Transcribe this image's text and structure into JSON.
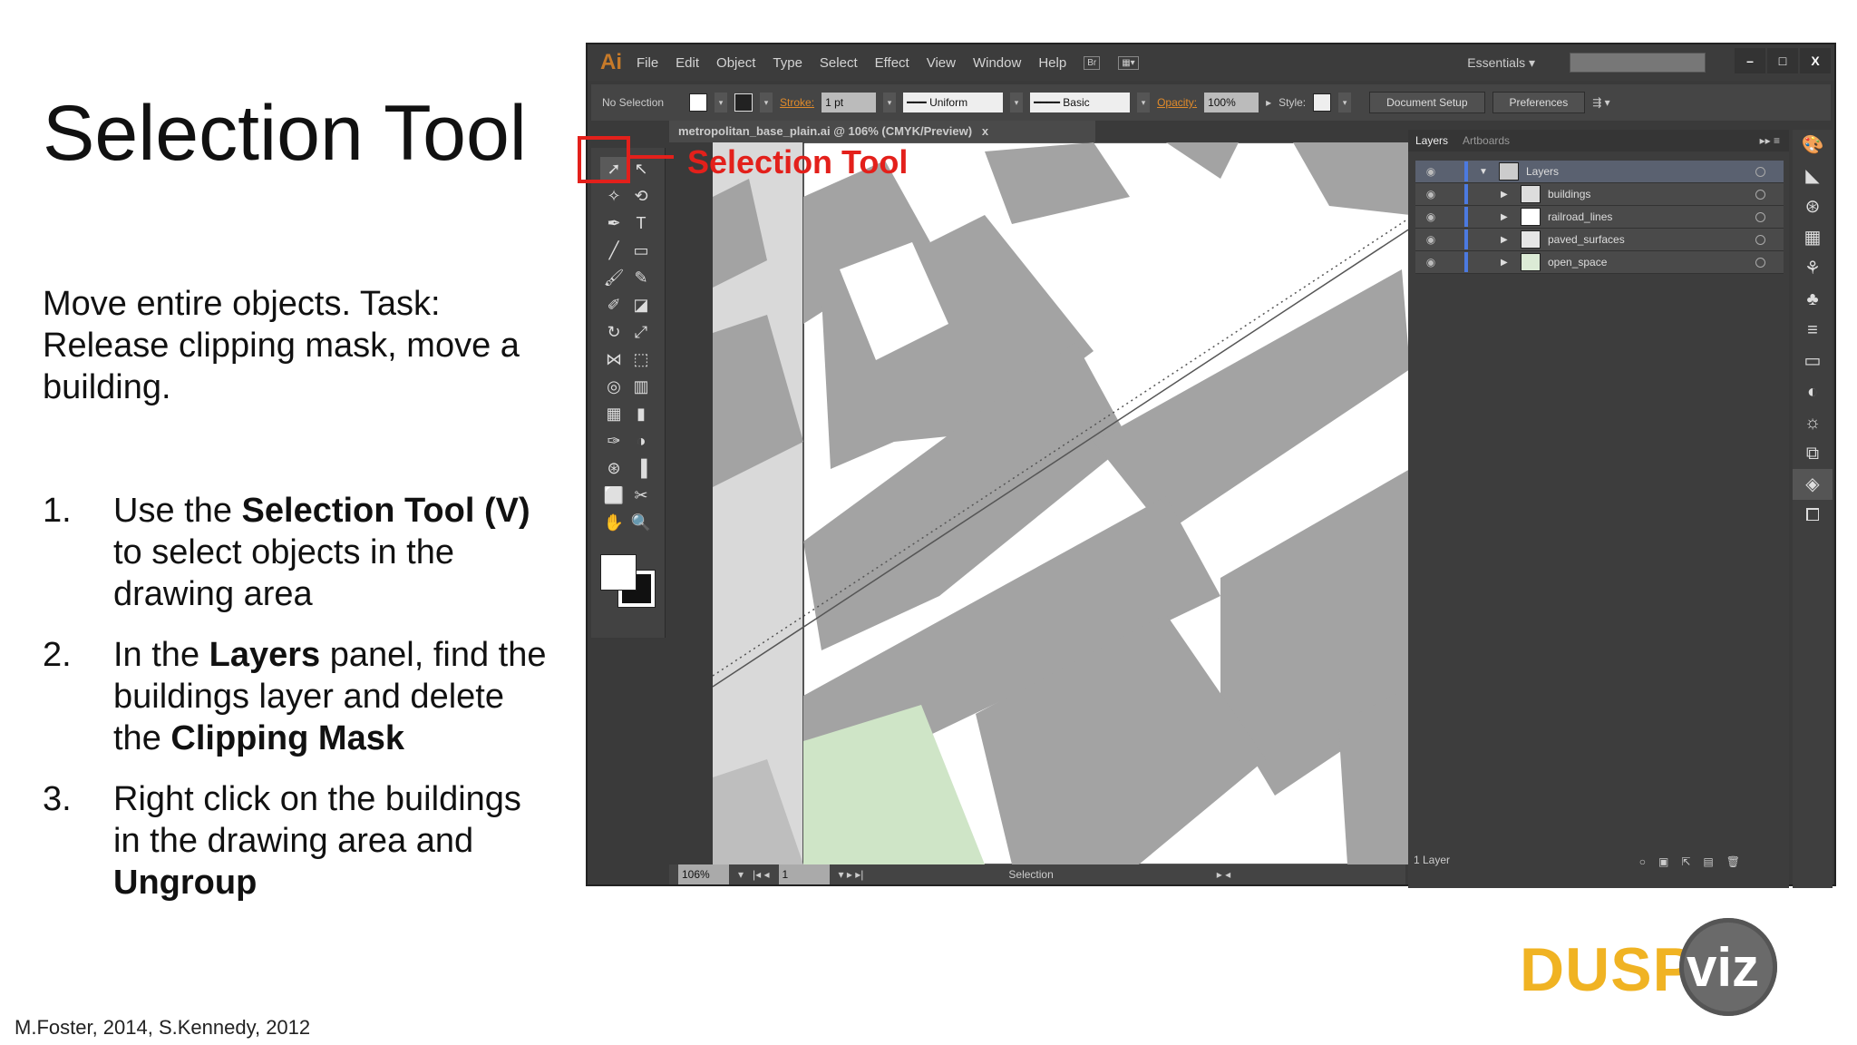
{
  "slide": {
    "title": "Selection Tool",
    "intro": "Move entire objects. Task: Release clipping mask, move a building.",
    "steps": [
      {
        "num": "1.",
        "parts": [
          {
            "t": "Use the "
          },
          {
            "t": "Selection Tool (V)",
            "b": true
          },
          {
            "t": " to select objects in the drawing area"
          }
        ]
      },
      {
        "num": "2.",
        "parts": [
          {
            "t": "In the "
          },
          {
            "t": "Layers",
            "b": true
          },
          {
            "t": " panel, find the buildings layer and delete the "
          },
          {
            "t": "Clipping Mask",
            "b": true
          }
        ]
      },
      {
        "num": "3.",
        "parts": [
          {
            "t": "Right click on the buildings in the drawing area and "
          },
          {
            "t": "Ungroup",
            "b": true
          }
        ]
      }
    ],
    "footer": "M.Foster, 2014, S.Kennedy, 2012",
    "logo": {
      "dusp": "DUSP",
      "viz": "viz"
    },
    "callout": "Selection Tool"
  },
  "app": {
    "logo": "Ai",
    "menu": [
      "File",
      "Edit",
      "Object",
      "Type",
      "Select",
      "Effect",
      "View",
      "Window",
      "Help"
    ],
    "br": "Br",
    "workspace": "Essentials",
    "control": {
      "selection": "No Selection",
      "stroke_label": "Stroke:",
      "stroke_value": "1 pt",
      "profile": "Uniform",
      "brush": "Basic",
      "opacity_label": "Opacity:",
      "opacity": "100%",
      "style_label": "Style:",
      "doc_setup": "Document Setup",
      "preferences": "Preferences"
    },
    "doc_tab": "metropolitan_base_plain.ai @ 106% (CMYK/Preview)",
    "close": "x",
    "status": {
      "zoom": "106%",
      "artboard": "1",
      "tool": "Selection"
    },
    "layers": {
      "tabs": [
        "Layers",
        "Artboards"
      ],
      "rows": [
        "Layers",
        "buildings",
        "railroad_lines",
        "paved_surfaces",
        "open_space"
      ],
      "footer": "1 Layer"
    }
  },
  "colors": {
    "accent": "#e3201b",
    "logo_gold": "#f0b323",
    "layer_bar": "#4c7ae0",
    "open_space": "#cfe5c7"
  }
}
